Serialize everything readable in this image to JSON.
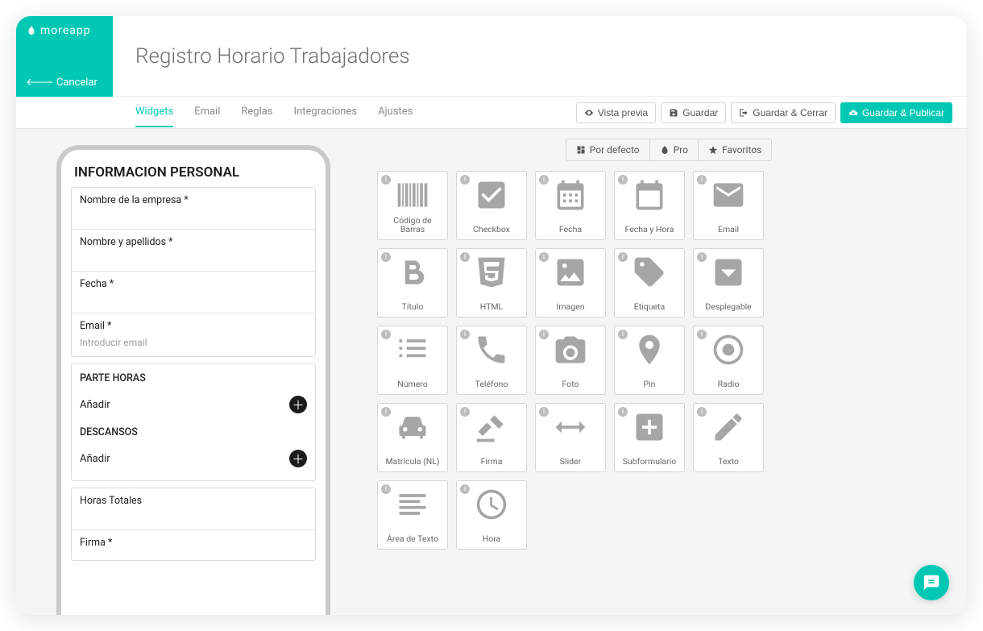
{
  "brand": {
    "name": "moreapp"
  },
  "cancel": "Cancelar",
  "title": "Registro Horario Trabajadores",
  "tabs": [
    "Widgets",
    "Email",
    "Reglas",
    "Integraciones",
    "Ajustes"
  ],
  "actions": {
    "preview": "Vista previa",
    "save": "Guardar",
    "save_close": "Guardar & Cerrar",
    "save_publish": "Guardar & Publicar"
  },
  "preview": {
    "section1_title": "INFORMACION PERSONAL",
    "fields": [
      {
        "label": "Nombre de la empresa *",
        "placeholder": ""
      },
      {
        "label": "Nombre y apellidos *",
        "placeholder": ""
      },
      {
        "label": "Fecha *",
        "placeholder": ""
      },
      {
        "label": "Email *",
        "placeholder": "Introducir email"
      }
    ],
    "section2_title": "PARTE HORAS",
    "section2_add": "Añadir",
    "section3_title": "DESCANSOS",
    "section3_add": "Añadir",
    "section4_field": "Horas Totales",
    "section5_field": "Firma *"
  },
  "widget_tabs": {
    "default": "Por defecto",
    "pro": "Pro",
    "favorites": "Favoritos"
  },
  "widgets": [
    "Código de Barras",
    "Checkbox",
    "Fecha",
    "Fecha y Hora",
    "Email",
    "Título",
    "HTML",
    "Imagen",
    "Etiqueta",
    "Desplegable",
    "Número",
    "Teléfono",
    "Foto",
    "Pin",
    "Radio",
    "Matrícula (NL)",
    "Firma",
    "Slider",
    "Subformulario",
    "Texto",
    "Área de Texto",
    "Hora"
  ]
}
